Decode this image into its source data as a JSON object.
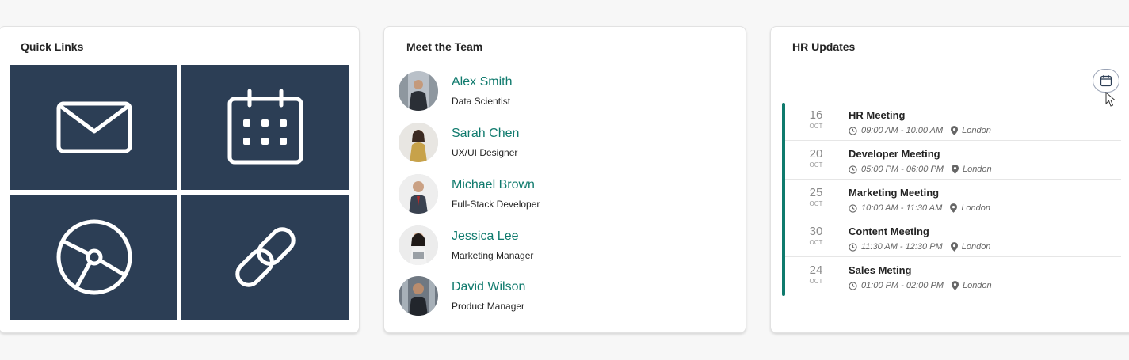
{
  "quick_links": {
    "title": "Quick Links",
    "tiles": [
      {
        "icon": "mail-icon"
      },
      {
        "icon": "calendar-icon"
      },
      {
        "icon": "disc-icon"
      },
      {
        "icon": "link-icon"
      }
    ],
    "tile_color": "#2c3e55"
  },
  "team": {
    "title": "Meet the Team",
    "members": [
      {
        "name": "Alex Smith",
        "role": "Data Scientist"
      },
      {
        "name": "Sarah Chen",
        "role": "UX/UI Designer"
      },
      {
        "name": "Michael Brown",
        "role": "Full-Stack Developer"
      },
      {
        "name": "Jessica Lee",
        "role": "Marketing Manager"
      },
      {
        "name": "David Wilson",
        "role": "Product Manager"
      }
    ],
    "accent": "#0f7a6d"
  },
  "hr": {
    "title": "HR Updates",
    "events": [
      {
        "day": "16",
        "month": "OCT",
        "title": "HR Meeting",
        "time": "09:00 AM - 10:00 AM",
        "location": "London"
      },
      {
        "day": "20",
        "month": "OCT",
        "title": "Developer Meeting",
        "time": "05:00 PM - 06:00 PM",
        "location": "London"
      },
      {
        "day": "25",
        "month": "OCT",
        "title": "Marketing Meeting",
        "time": "10:00 AM - 11:30 AM",
        "location": "London"
      },
      {
        "day": "30",
        "month": "OCT",
        "title": "Content Meeting",
        "time": "11:30 AM - 12:30 PM",
        "location": "London"
      },
      {
        "day": "24",
        "month": "OCT",
        "title": "Sales Meting",
        "time": "01:00 PM - 02:00 PM",
        "location": "London"
      }
    ]
  }
}
